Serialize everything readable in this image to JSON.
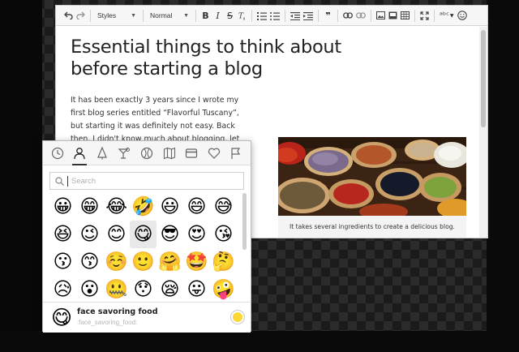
{
  "toolbar": {
    "styles_label": "Styles",
    "format_label": "Normal"
  },
  "document": {
    "title": "Essential things to think about before starting a blog",
    "paragraph": "It has been exactly 3 years since I wrote my first blog series entitled “Flavorful Tuscany”, but starting it was definitely not easy. Back then, I didn't know much about blogging, let alone think",
    "image_caption": "It takes several ingredients to create a delicious blog."
  },
  "emoji_panel": {
    "categories": [
      {
        "name": "recent",
        "icon": "clock-icon"
      },
      {
        "name": "people",
        "icon": "person-icon",
        "active": true
      },
      {
        "name": "nature",
        "icon": "tree-icon"
      },
      {
        "name": "food",
        "icon": "cocktail-icon"
      },
      {
        "name": "activities",
        "icon": "ball-icon"
      },
      {
        "name": "travel",
        "icon": "map-icon"
      },
      {
        "name": "objects",
        "icon": "card-icon"
      },
      {
        "name": "symbols",
        "icon": "heart-icon"
      },
      {
        "name": "flags",
        "icon": "flag-icon"
      }
    ],
    "search_placeholder": "Search",
    "emojis": [
      "😀",
      "😁",
      "😂",
      "🤣",
      "😃",
      "😄",
      "😅",
      "😆",
      "😉",
      "😊",
      "😋",
      "😎",
      "😍",
      "😘",
      "😗",
      "😙",
      "☺️",
      "🙂",
      "🤗",
      "🤩",
      "🤔",
      "😥",
      "😮",
      "🤐",
      "😯",
      "😪",
      "😛",
      "🤪"
    ],
    "selected_index": 10,
    "preview": {
      "emoji": "😋",
      "name": "face savoring food",
      "shortcode": ":face_savoring_food:"
    },
    "skin_tone_color": "#fdd835"
  }
}
